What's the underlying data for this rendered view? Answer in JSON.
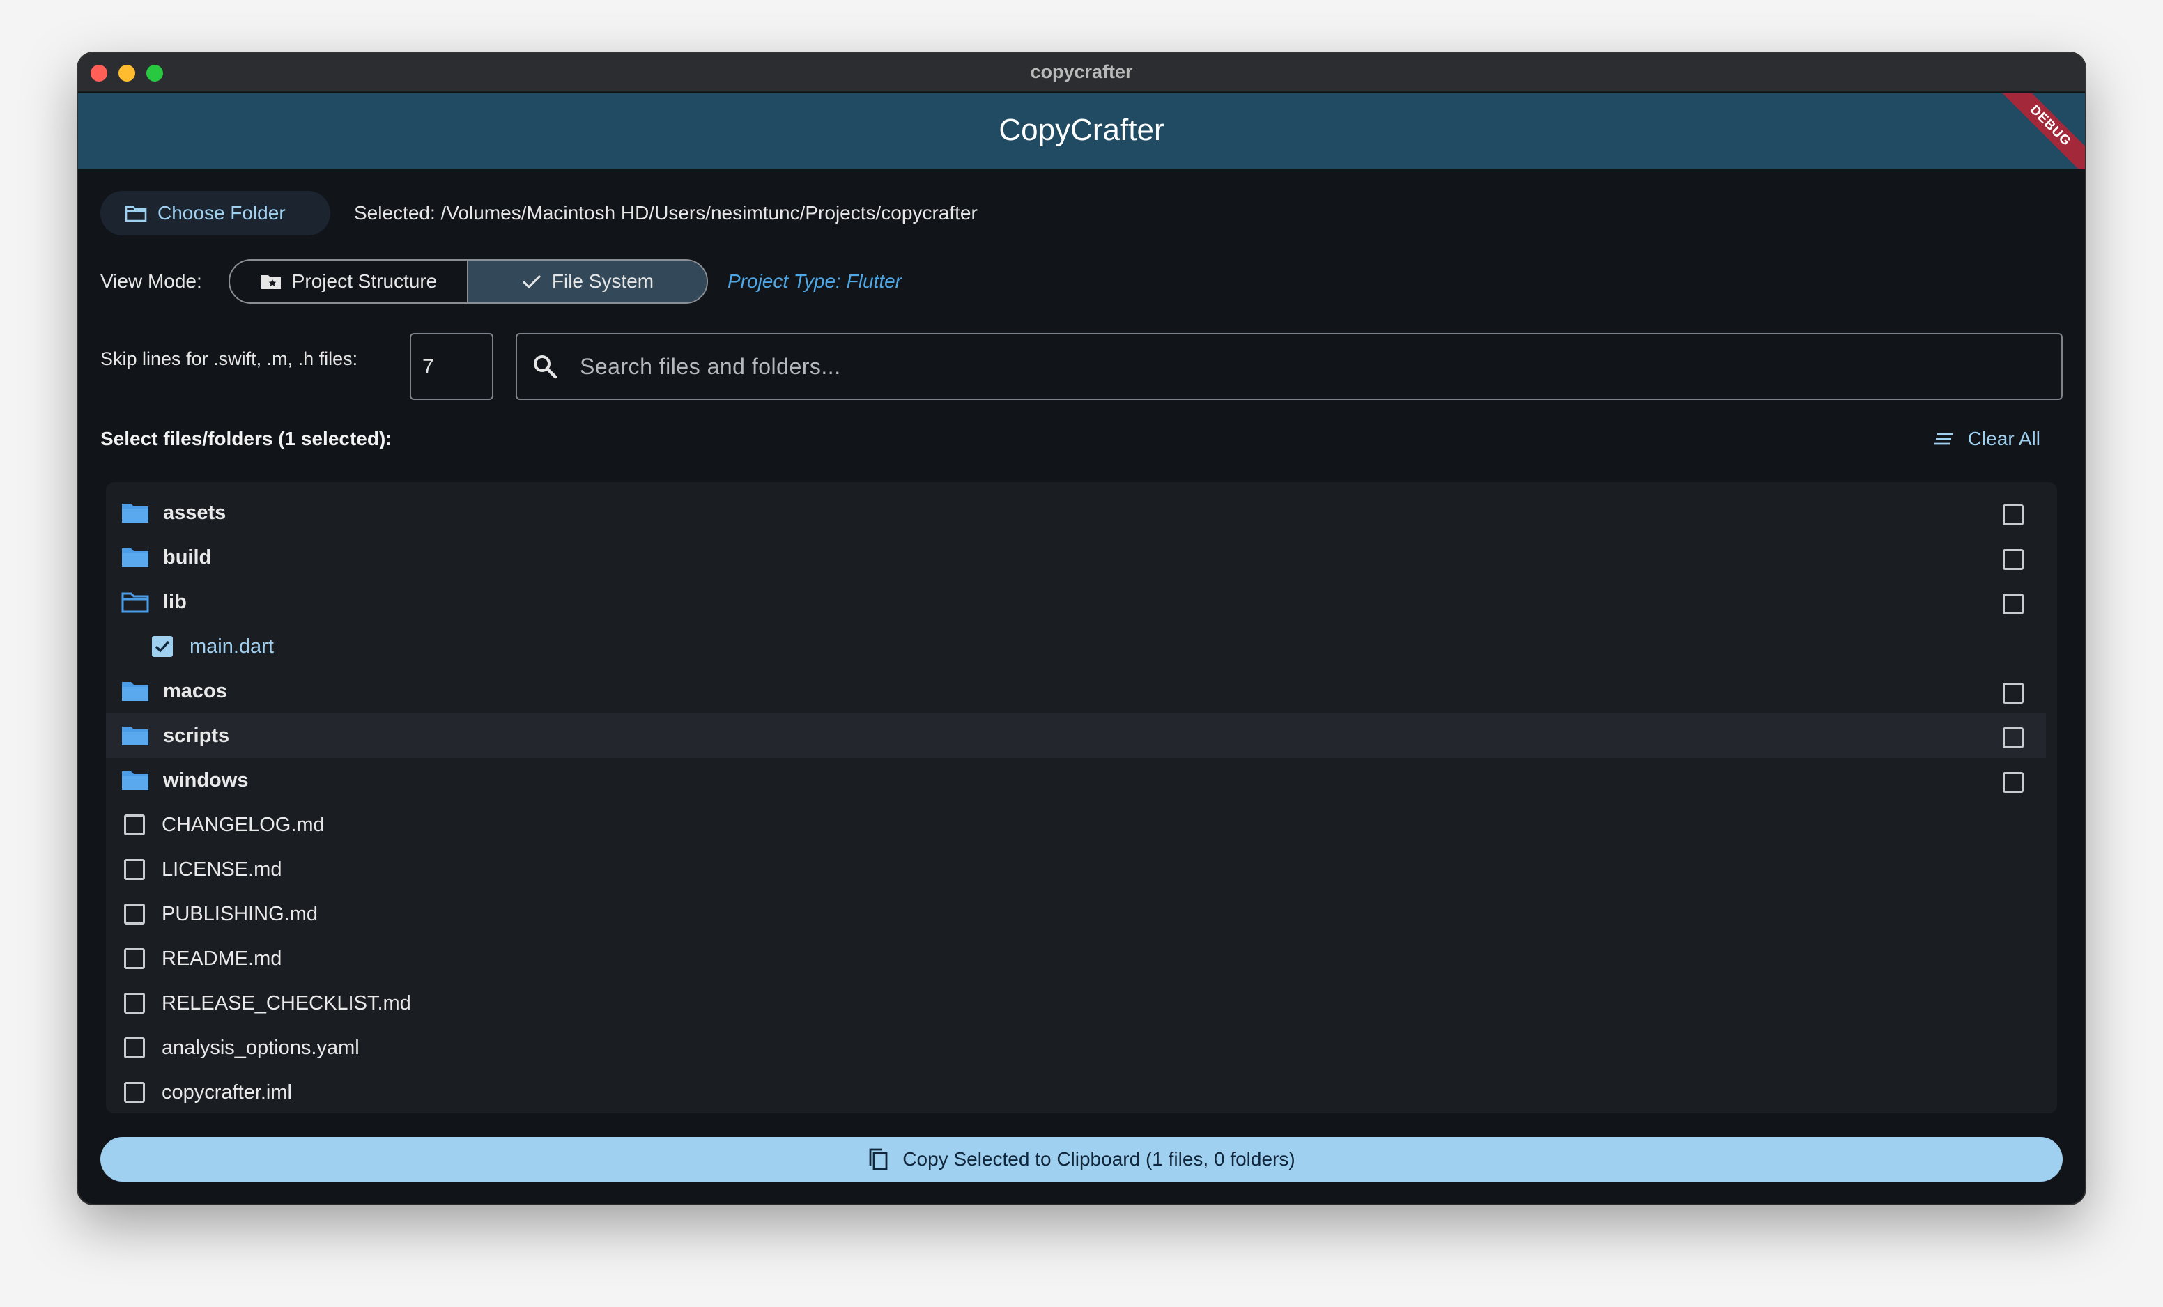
{
  "window": {
    "title": "copycrafter"
  },
  "appbar": {
    "title": "CopyCrafter",
    "debug_badge": "DEBUG"
  },
  "folder": {
    "choose_label": "Choose Folder",
    "selected_text": "Selected: /Volumes/Macintosh HD/Users/nesimtunc/Projects/copycrafter"
  },
  "view_mode": {
    "label": "View Mode:",
    "options": [
      "Project Structure",
      "File System"
    ],
    "selected": "File System",
    "project_type": "Project Type: Flutter"
  },
  "skip": {
    "label": "Skip lines for .swift, .m, .h files:",
    "value": "7"
  },
  "search": {
    "placeholder": "Search files and folders..."
  },
  "selection": {
    "header": "Select files/folders (1 selected):",
    "clear_label": "Clear All"
  },
  "tree": [
    {
      "name": "assets",
      "type": "folder",
      "checked": false
    },
    {
      "name": "build",
      "type": "folder",
      "checked": false
    },
    {
      "name": "lib",
      "type": "folder-open",
      "checked": false
    },
    {
      "name": "main.dart",
      "type": "file",
      "checked": true,
      "child": true
    },
    {
      "name": "macos",
      "type": "folder",
      "checked": false
    },
    {
      "name": "scripts",
      "type": "folder",
      "checked": false,
      "hover": true
    },
    {
      "name": "windows",
      "type": "folder",
      "checked": false
    },
    {
      "name": "CHANGELOG.md",
      "type": "file",
      "checked": false
    },
    {
      "name": "LICENSE.md",
      "type": "file",
      "checked": false
    },
    {
      "name": "PUBLISHING.md",
      "type": "file",
      "checked": false
    },
    {
      "name": "README.md",
      "type": "file",
      "checked": false
    },
    {
      "name": "RELEASE_CHECKLIST.md",
      "type": "file",
      "checked": false
    },
    {
      "name": "analysis_options.yaml",
      "type": "file",
      "checked": false
    },
    {
      "name": "copycrafter.iml",
      "type": "file",
      "checked": false
    }
  ],
  "copy_button": {
    "label": "Copy Selected to Clipboard (1 files, 0 folders)"
  },
  "colors": {
    "appbar": "#204b62",
    "accent": "#9fd0f0",
    "link": "#4fa7e6",
    "background": "#111418"
  }
}
